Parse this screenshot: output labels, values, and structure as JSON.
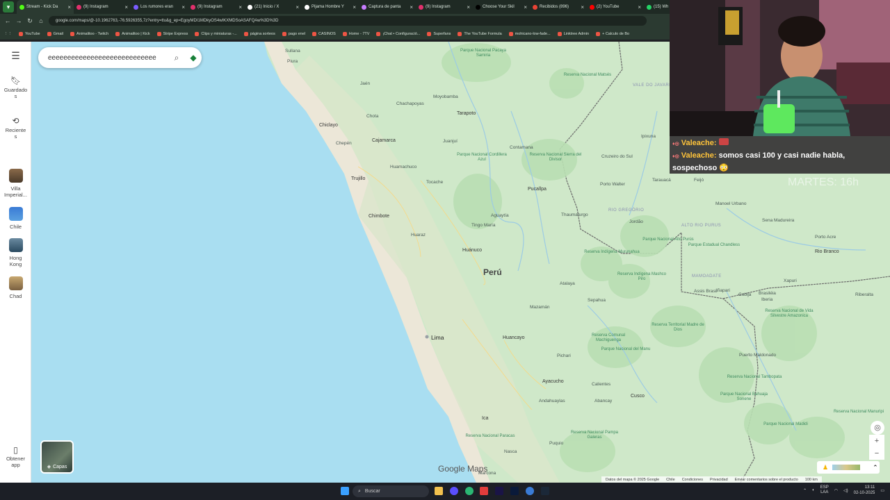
{
  "browser": {
    "tabs": [
      {
        "label": "Stream - Kick Da",
        "color": "#53fc18",
        "active": true
      },
      {
        "label": "(9) Instagram",
        "color": "#e1306c"
      },
      {
        "label": "Los rumores eran",
        "color": "#7a5cff"
      },
      {
        "label": "(9) Instagram",
        "color": "#e1306c"
      },
      {
        "label": "(21) Inicio / X",
        "color": "#ffffff"
      },
      {
        "label": "Pijama Hombre Y",
        "color": "#ffffff"
      },
      {
        "label": "Captura de panta",
        "color": "#c77dff"
      },
      {
        "label": "(9) Instagram",
        "color": "#e1306c"
      },
      {
        "label": "Choose Your Skil",
        "color": "#000000"
      },
      {
        "label": "Recibidos (896)",
        "color": "#ea4335"
      },
      {
        "label": "(2) YouTube",
        "color": "#ff0000"
      },
      {
        "label": "(15) Wh",
        "color": "#25d366"
      }
    ],
    "url": "google.com/maps/@-10.1962763,-76.5926355,7z?entry=ttu&g_ep=EgoyMDI1MDkyOS4wIKXMDSoASAFQAw%3D%3D",
    "bookmarks": [
      "YouTube",
      "Gmail",
      "Animalitoo - Twitch",
      "Animalitoo | Kick",
      "Stripe Express",
      "Clips y miniaturas -...",
      "página sorteos",
      "pago enel",
      "CASINOS",
      "Home - 7TV",
      "¡Chat • Configuració...",
      "Superfans",
      "The YouTube Formula",
      "mohicano-low-fade...",
      "Linktree Admin",
      "+ Calculo de Bo"
    ]
  },
  "sidebar": {
    "menu_icon": "menu-icon",
    "saved_label": "Guardado\ns",
    "recent_label": "Reciente\ns",
    "recents": [
      {
        "label": "Villa\nImperial..."
      },
      {
        "label": "Chile"
      },
      {
        "label": "Hong\nKong"
      },
      {
        "label": "Chad"
      }
    ],
    "get_app_label": "Obtener\napp"
  },
  "search": {
    "query": "eeeeeeeeeeeeeeeeeeeeeeeeeeee"
  },
  "map": {
    "country": "Perú",
    "cities": [
      "Sullana",
      "Piura",
      "Jaén",
      "Chachapoyas",
      "Moyobamba",
      "Tarapoto",
      "Chota",
      "Chiclayo",
      "Chepén",
      "Cajamarca",
      "Juanjuí",
      "Trujillo",
      "Huamachuco",
      "Tocache",
      "Chimbote",
      "Huaraz",
      "Tingo María",
      "Aguaytía",
      "Pucallpa",
      "Huánuco",
      "Lima",
      "Mazamán",
      "Huancayo",
      "Pichari",
      "Ayacucho",
      "Andahuaylas",
      "Abancay",
      "Calientes",
      "Cusco",
      "Ica",
      "Nasca",
      "Puquio",
      "Marcona",
      "Thaumaturgo",
      "Cruzeiro do Sul",
      "Tarauacá",
      "Feijó",
      "Porto Walter",
      "Jordão",
      "Manoel Urbano",
      "Sena Madureira",
      "Porto Acre",
      "Rio Branco",
      "Xapuri",
      "Brasiléia",
      "Cobija",
      "Riberalta",
      "Puerto Maldonado",
      "Iñapari",
      "Assis Brasil",
      "Contamana",
      "Ipixuna",
      "Sepahua",
      "Atalaya",
      "Iberia"
    ],
    "regions": [
      "VALE DO JAVARI",
      "ALTO RIO PURUS",
      "MAMOADATE",
      "RIO GREGÓRIO"
    ],
    "parks": [
      "Parque Nacional Pacaya Samiria",
      "Reserva Nacional Matsés",
      "Parque Nacional Cordillera Azul",
      "Reserva Nacional Sierra del Divisor",
      "Reserva Comunal Machiguenga",
      "Reserva Territorial Madre de Dios",
      "Parque Nacional del Manu",
      "Reserva Nacional de Vida Silvestre Amazonica",
      "Parque Nacional Bahuaja Sonene",
      "Reserva Nacional Pampa Galeras",
      "Parque Estadual Chandless",
      "Reserva Indígena Murunahua",
      "Reserva Indígena Mashco Piro",
      "Parque Nacional Alto Purús",
      "Reserva Nacional Paracas",
      "Reserva Nacional Tambopata",
      "Reserva Nacional Manuripi",
      "Parque Nacional Madidi"
    ],
    "google_logo": "Google Maps",
    "footer": [
      "Datos del mapa © 2025 Google",
      "Chile",
      "Condiciones",
      "Privacidad",
      "Enviar comentarios sobre el producto",
      "100 km"
    ],
    "layers_label": "Capas"
  },
  "stream": {
    "chat": [
      {
        "user": "Valeache:",
        "msg": ""
      },
      {
        "user": "Valeache:",
        "msg": "somos casi 100 y casi nadie habla, sospechoso"
      }
    ],
    "overlay_text": "MARTES: 16h"
  },
  "taskbar": {
    "search_label": "Buscar",
    "lang": "ESP\nLAA",
    "time": "13:11",
    "date": "02-10-2025"
  }
}
